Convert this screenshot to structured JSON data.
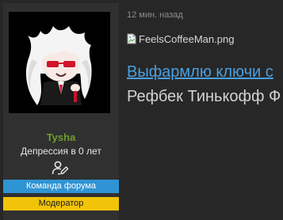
{
  "user": {
    "avatar": "cartoon-character-avatar",
    "name": "Tysha",
    "title": "Депрессия в 0 лет",
    "icon": "user-edit-icon",
    "banners": {
      "team": "Команда форума",
      "moderator": "Модератор"
    }
  },
  "message": {
    "time": "12 мин. назад",
    "image_alt": "FeelsCoffeeMan.png",
    "link_text": "Выфармлю ключи с",
    "text_line": "Рефбек Тинькофф Ф"
  },
  "colors": {
    "username": "#6f9c2e",
    "link": "#4a9fe0",
    "team_banner": "#2f94d4",
    "moderator_banner": "#f2c409"
  }
}
